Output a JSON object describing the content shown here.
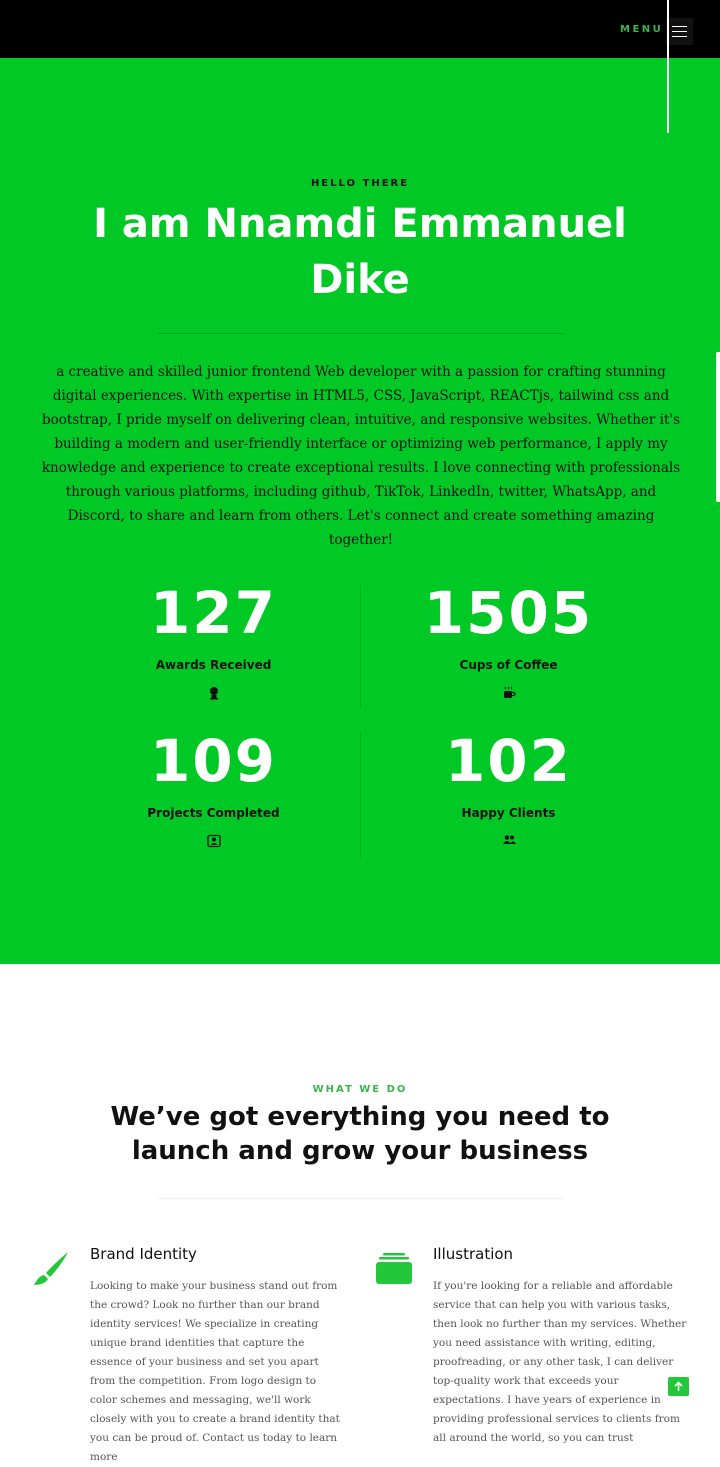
{
  "header": {
    "menu_label": "MENU"
  },
  "hero": {
    "pre_title": "HELLO THERE",
    "title": "I am Nnamdi Emmanuel Dike",
    "description": "a creative and skilled junior frontend Web developer with a passion for crafting stunning digital experiences. With expertise in HTML5, CSS, JavaScript, REACTjs, tailwind css and bootstrap, I pride myself on delivering clean, intuitive, and responsive websites. Whether it's building a modern and user-friendly interface or optimizing web performance, I apply my knowledge and experience to create exceptional results. I love connecting with professionals through various platforms, including github, TikTok, LinkedIn, twitter, WhatsApp, and Discord, to share and learn from others. Let's connect and create something amazing together!",
    "stats": [
      {
        "number": "127",
        "label": "Awards Received",
        "icon": "award-icon"
      },
      {
        "number": "1505",
        "label": "Cups of Coffee",
        "icon": "coffee-icon"
      },
      {
        "number": "109",
        "label": "Projects Completed",
        "icon": "user-square-icon"
      },
      {
        "number": "102",
        "label": "Happy Clients",
        "icon": "users-icon"
      }
    ]
  },
  "services": {
    "pre_title": "WHAT WE DO",
    "title": "We’ve got everything you need to launch and grow your business",
    "items": [
      {
        "title": "Brand Identity",
        "icon": "paintbrush-icon",
        "text": "Looking to make your business stand out from the crowd? Look no further than our brand identity services! We specialize in creating unique brand identities that capture the essence of your business and set you apart from the competition. From logo design to color schemes and messaging, we'll work closely with you to create a brand identity that you can be proud of. Contact us today to learn more"
      },
      {
        "title": "Illustration",
        "icon": "layers-icon",
        "text": "If you're looking for a reliable and affordable service that can help you with various tasks, then look no further than my services. Whether you need assistance with writing, editing, proofreading, or any other task, I can deliver top-quality work that exceeds your expectations. I have years of experience in providing professional services to clients from all around the world, so you can trust"
      }
    ]
  },
  "colors": {
    "accent": "#00c925",
    "header_bg": "#000000",
    "menu_text": "#39b54a",
    "eyebrow": "#39b54a",
    "icon_green": "#22c73a"
  }
}
